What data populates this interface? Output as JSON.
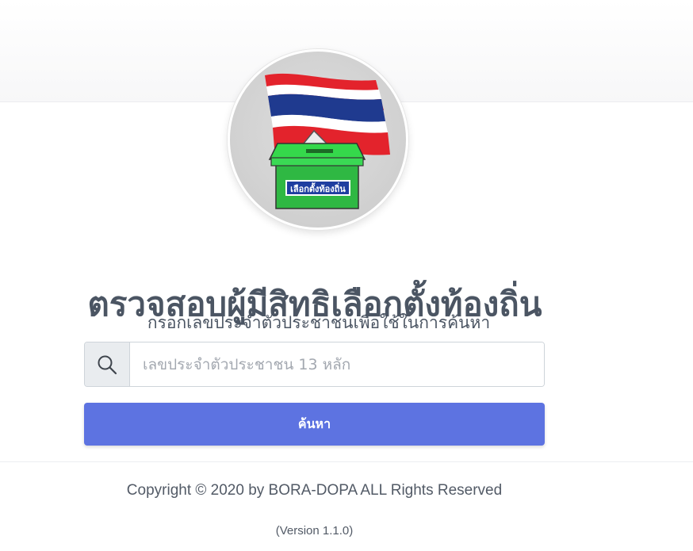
{
  "header": {
    "logo": {
      "icon": "thai-flag-ballot-box-logo",
      "ballot_label": "เลือกตั้งท้องถิ่น"
    }
  },
  "main": {
    "title": "ตรวจสอบผู้มีสิทธิเลือกตั้งท้องถิ่น",
    "subtitle": "กรอกเลขประจำตัวประชาชนเพื่อใช้ในการค้นหา",
    "search": {
      "icon": "search-icon",
      "value": "",
      "placeholder": "เลขประจำตัวประชาชน 13 หลัก"
    },
    "search_button_label": "ค้นหา"
  },
  "footer": {
    "copyright": "Copyright © 2020 by BORA-DOPA ALL Rights Reserved",
    "version": "(Version 1.1.0)"
  },
  "colors": {
    "primary_button": "#5d73e1",
    "text": "#4b5563",
    "flag_red": "#e3232c",
    "flag_blue": "#1f3a8f",
    "ballot_green": "#2fb843"
  }
}
